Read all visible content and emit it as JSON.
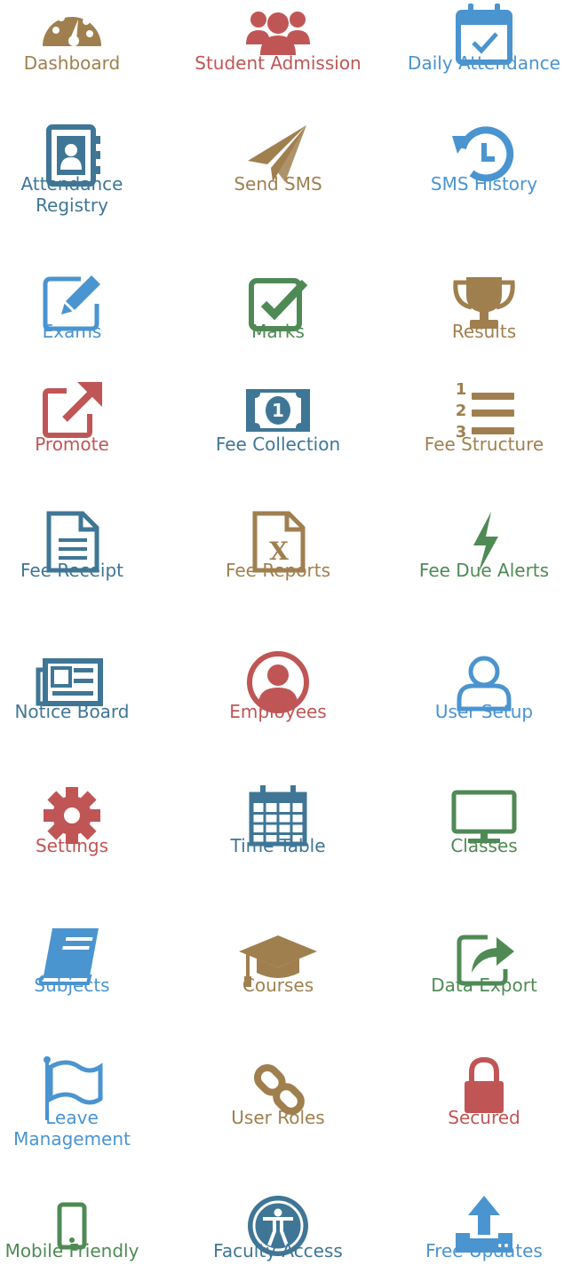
{
  "colors": {
    "gold": "#a07f4f",
    "red": "#bf5655",
    "blue": "#4a94d0",
    "teal": "#3f7696",
    "green": "#4f8a55"
  },
  "features": [
    {
      "label": "Dashboard",
      "icon": "dashboard-gauge-icon",
      "color": "gold"
    },
    {
      "label": "Student Admission",
      "icon": "users-group-icon",
      "color": "red"
    },
    {
      "label": "Daily Attendance",
      "icon": "calendar-check-icon",
      "color": "blue"
    },
    {
      "label": "Attendance Registry",
      "icon": "contact-book-icon",
      "color": "teal"
    },
    {
      "label": "Send SMS",
      "icon": "paper-plane-icon",
      "color": "gold"
    },
    {
      "label": "SMS History",
      "icon": "history-clock-icon",
      "color": "blue"
    },
    {
      "label": "Exams",
      "icon": "edit-pencil-icon",
      "color": "blue"
    },
    {
      "label": "Marks",
      "icon": "checkbox-check-icon",
      "color": "green"
    },
    {
      "label": "Results",
      "icon": "trophy-icon",
      "color": "gold"
    },
    {
      "label": "Promote",
      "icon": "external-link-icon",
      "color": "red"
    },
    {
      "label": "Fee Collection",
      "icon": "money-bill-icon",
      "color": "teal"
    },
    {
      "label": "Fee Structure",
      "icon": "numbered-list-icon",
      "color": "gold"
    },
    {
      "label": "Fee Receipt",
      "icon": "document-text-icon",
      "color": "teal"
    },
    {
      "label": "Fee Reports",
      "icon": "excel-file-icon",
      "color": "gold"
    },
    {
      "label": "Fee Due Alerts",
      "icon": "lightning-bolt-icon",
      "color": "green"
    },
    {
      "label": "Notice Board",
      "icon": "newspaper-icon",
      "color": "teal"
    },
    {
      "label": "Employees",
      "icon": "user-circle-icon",
      "color": "red"
    },
    {
      "label": "User Setup",
      "icon": "user-outline-icon",
      "color": "blue"
    },
    {
      "label": "Settings",
      "icon": "gear-icon",
      "color": "red"
    },
    {
      "label": "Time Table",
      "icon": "calendar-grid-icon",
      "color": "teal"
    },
    {
      "label": "Classes",
      "icon": "monitor-icon",
      "color": "green"
    },
    {
      "label": "Subjects",
      "icon": "book-icon",
      "color": "blue"
    },
    {
      "label": "Courses",
      "icon": "graduation-cap-icon",
      "color": "gold"
    },
    {
      "label": "Data Export",
      "icon": "share-square-icon",
      "color": "green"
    },
    {
      "label": "Leave Management",
      "icon": "flag-icon",
      "color": "blue"
    },
    {
      "label": "User Roles",
      "icon": "chain-link-icon",
      "color": "gold"
    },
    {
      "label": "Secured",
      "icon": "lock-icon",
      "color": "red"
    },
    {
      "label": "Mobile Friendly",
      "icon": "mobile-phone-icon",
      "color": "green"
    },
    {
      "label": "Faculty Access",
      "icon": "accessibility-icon",
      "color": "teal"
    },
    {
      "label": "Free Updates",
      "icon": "upload-tray-icon",
      "color": "blue"
    }
  ]
}
